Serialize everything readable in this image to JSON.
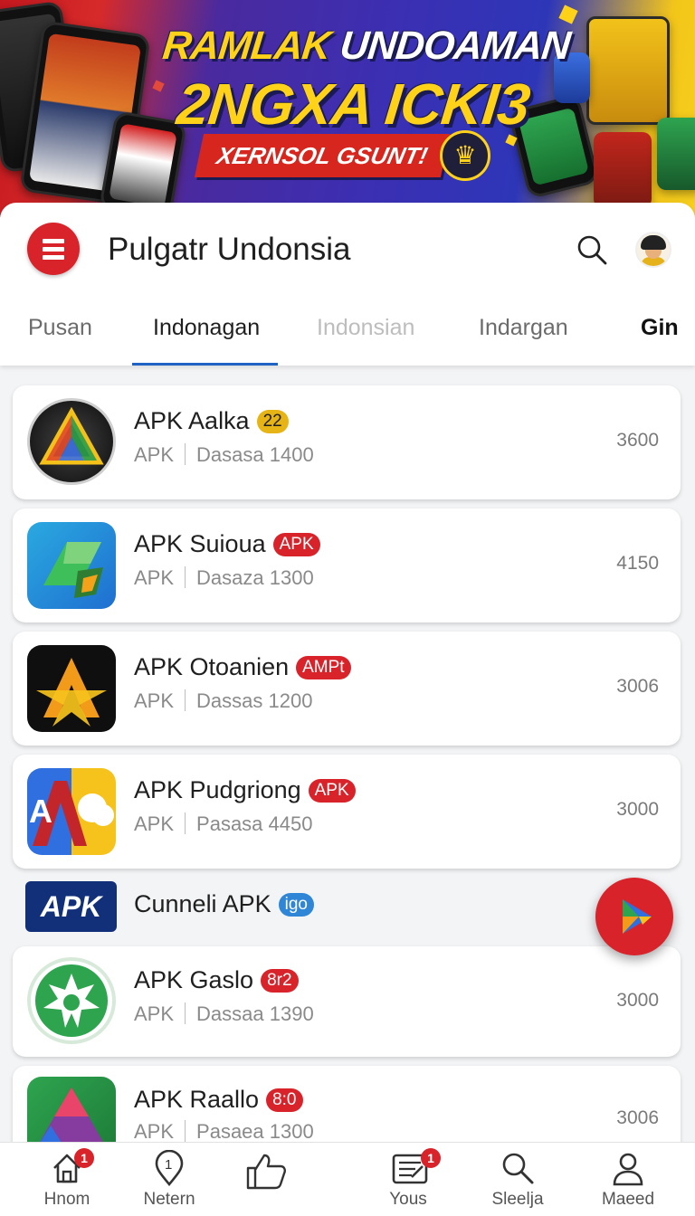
{
  "banner": {
    "line1_a": "RAMLAK",
    "line1_b": "UNDOAMAN",
    "line2": "2NGXA ICKI3",
    "subtitle": "XERNSOL GSUNT!"
  },
  "header": {
    "title": "Pulgatr Undonsia",
    "tabs": [
      "Pusan",
      "Indonagan",
      "Indonsian",
      "Indargan",
      "Gin"
    ],
    "active_tab": "Indonagan"
  },
  "apps": [
    {
      "name": "APK Aalka",
      "badge": "22",
      "badge_color": "#e7b416",
      "type": "APK",
      "meta": "Dasasa 1400",
      "count": "3600",
      "icon": "prism-icon"
    },
    {
      "name": "APK Suioua",
      "badge": "APK",
      "badge_color": "#d9232a",
      "type": "APK",
      "meta": "Dasaza 1300",
      "count": "4150",
      "icon": "folder-map-icon"
    },
    {
      "name": "APK Otoanien",
      "badge": "AMPt",
      "badge_color": "#d9232a",
      "type": "APK",
      "meta": "Dassas 1200",
      "count": "3006",
      "icon": "star-a-icon"
    },
    {
      "name": "APK Pudgriong",
      "badge": "APK",
      "badge_color": "#d9232a",
      "type": "APK",
      "meta": "Pasasa 4450",
      "count": "3000",
      "icon": "cloud-a-icon"
    }
  ],
  "plain_item": {
    "chip": "APK",
    "name": "Cunneli APK",
    "badge": "igo",
    "badge_color": "#2f86d6"
  },
  "apps2": [
    {
      "name": "APK Gaslo",
      "badge": "8r2",
      "badge_color": "#d9232a",
      "type": "APK",
      "meta": "Dassaa 1390",
      "count": "3000",
      "icon": "gear-star-icon"
    },
    {
      "name": "APK Raallo",
      "badge": "8:0",
      "badge_color": "#d9232a",
      "type": "APK",
      "meta": "Pasaea 1300",
      "count": "3006",
      "icon": "drive-icon"
    }
  ],
  "nav": {
    "items": [
      {
        "label": "Hnom",
        "icon": "home-icon",
        "badge": "1"
      },
      {
        "label": "Netern",
        "icon": "location-pin-icon",
        "badge": ""
      },
      {
        "label": "",
        "icon": "thumbs-up-icon",
        "badge": ""
      },
      {
        "label": "Yous",
        "icon": "document-icon",
        "badge": "1"
      },
      {
        "label": "Sleelja",
        "icon": "search-icon",
        "badge": ""
      },
      {
        "label": "Maeed",
        "icon": "profile-icon",
        "badge": ""
      }
    ]
  },
  "colors": {
    "accent": "#d9232a",
    "tab_indicator": "#1e63c4",
    "banner_text": "#ffd21a"
  }
}
